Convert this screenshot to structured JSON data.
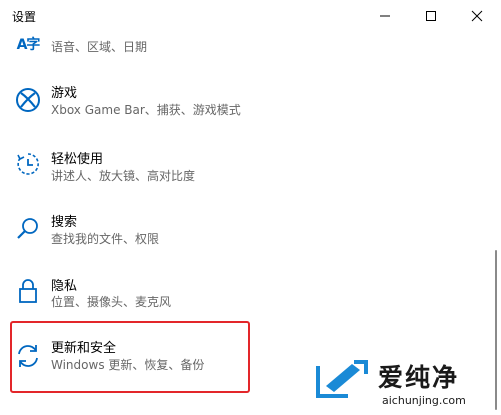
{
  "window": {
    "title": "设置"
  },
  "accent_color": "#0067c0",
  "highlight_color": "#e3262a",
  "items": [
    {
      "icon": "language-icon",
      "glyph": "A字",
      "title": "",
      "desc": "语音、区域、日期"
    },
    {
      "icon": "xbox-icon",
      "title": "游戏",
      "desc": "Xbox Game Bar、捕获、游戏模式"
    },
    {
      "icon": "ease-of-access-icon",
      "title": "轻松使用",
      "desc": "讲述人、放大镜、高对比度"
    },
    {
      "icon": "search-icon",
      "title": "搜索",
      "desc": "查找我的文件、权限"
    },
    {
      "icon": "lock-icon",
      "title": "隐私",
      "desc": "位置、摄像头、麦克风"
    },
    {
      "icon": "update-sync-icon",
      "title": "更新和安全",
      "desc": "Windows 更新、恢复、备份"
    }
  ],
  "watermark": {
    "text": "爱纯净",
    "url": "aichunjing.com"
  }
}
